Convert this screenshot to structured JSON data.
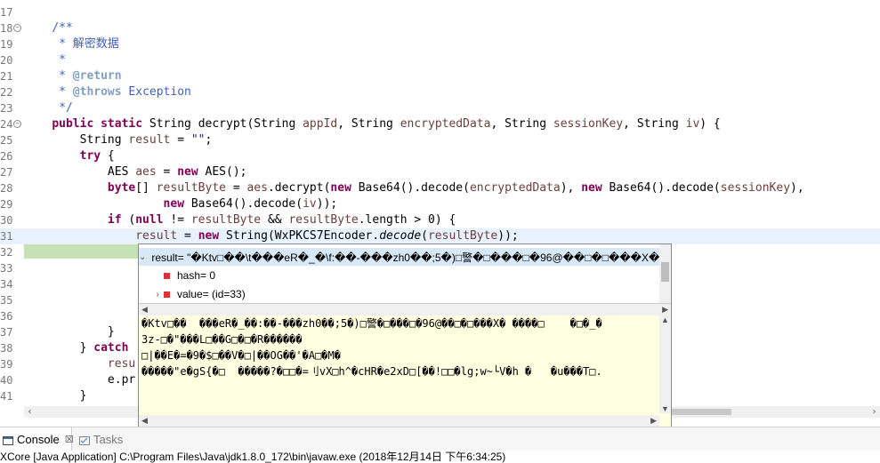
{
  "editor": {
    "lines": [
      {
        "num": "17",
        "html": ""
      },
      {
        "num": "18",
        "fold": "⊖",
        "html": "    <span class=\"cm\">/**</span>"
      },
      {
        "num": "19",
        "html": "<span class=\"cm\">     * 解密数据</span>"
      },
      {
        "num": "20",
        "html": "<span class=\"cm\">     *</span>"
      },
      {
        "num": "21",
        "html": "<span class=\"cm\">     * </span><span class=\"tag\">@return</span>"
      },
      {
        "num": "22",
        "html": "<span class=\"cm\">     * </span><span class=\"tag\">@throws</span><span class=\"cm\"> Exception</span>"
      },
      {
        "num": "23",
        "html": "<span class=\"cm\">     */</span>"
      },
      {
        "num": "24",
        "fold": "⊖",
        "html": "    <span class=\"kw\">public</span> <span class=\"kw\">static</span> String decrypt(String <span class=\"var\">appId</span>, String <span class=\"var\">encryptedData</span>, String <span class=\"var\">sessionKey</span>, String <span class=\"var\">iv</span>) {"
      },
      {
        "num": "25",
        "html": "        String <span class=\"var\">result</span> = <span class=\"str\">\"\"</span>;"
      },
      {
        "num": "26",
        "html": "        <span class=\"kw\">try</span> {"
      },
      {
        "num": "27",
        "html": "            AES <span class=\"var\">aes</span> = <span class=\"kw\">new</span> AES();"
      },
      {
        "num": "28",
        "html": "            <span class=\"kw\">byte</span>[] <span class=\"var\">resultByte</span> = <span class=\"var\">aes</span>.decrypt(<span class=\"kw\">new</span> Base64().decode(<span class=\"var\">encryptedData</span>), <span class=\"kw\">new</span> Base64().decode(<span class=\"var\">sessionKey</span>),"
      },
      {
        "num": "29",
        "html": "                    <span class=\"kw\">new</span> Base64().decode(<span class=\"var\">iv</span>));"
      },
      {
        "num": "30",
        "html": "            <span class=\"kw\">if</span> (<span class=\"kw\">null</span> != <span class=\"var\">resultByte</span> &amp;&amp; <span class=\"var\">resultByte</span>.length &gt; 0) {"
      },
      {
        "num": "31",
        "cur": true,
        "html": "                <span class=\"var\">result</span> = <span class=\"kw\">new</span> String(WxPKCS7Encoder.<span class=\"it\">decode</span>(<span class=\"var\">resultByte</span>));"
      },
      {
        "num": "32",
        "html": ""
      },
      {
        "num": "33",
        "html": ""
      },
      {
        "num": "34",
        "html": ""
      },
      {
        "num": "35",
        "html": ""
      },
      {
        "num": "36",
        "html": ""
      },
      {
        "num": "37",
        "html": "            }"
      },
      {
        "num": "38",
        "html": "        } <span class=\"kw\">catch</span>"
      },
      {
        "num": "39",
        "html": "            <span class=\"var\">resu</span>"
      },
      {
        "num": "40",
        "html": "            e.pr"
      },
      {
        "num": "41",
        "html": "        }"
      }
    ]
  },
  "debug_popup": {
    "tree": [
      {
        "expander": "⌄",
        "name": "result",
        "value": "\"�Ktv□��\\t���eR�_�\\f:��-���zh0��;5�)□警�□���□�96@��□�□���X� ����□\\t�□�_�'□g"
      },
      {
        "expander": "",
        "name": "hash",
        "value": "0"
      },
      {
        "expander": "›",
        "name": "value",
        "value": "(id=33)"
      }
    ],
    "detail_lines": [
      "�Ktv□��  ���eR�_��:��-���zh0��;5�)□警�□���□�96@��□�□���X� ����□    �□�_�",
      "3z-□�\"���L□��G□�□�R������",
      "□|��E�=�9�$□��V�□|��OG��'�A□�M�",
      "�����\"e�gS{�□  �����?�□□�=刂vX□h^�cHR�e2xD□[��!□□�lg;w~└V�h �   �u���T□."
    ]
  },
  "bottom_tabs": [
    {
      "label": "Console",
      "close": "☒",
      "icon": "console-icon"
    },
    {
      "label": "Tasks",
      "icon": "tasks-icon"
    }
  ],
  "status_line": "XCore [Java Application] C:\\Program Files\\Java\\jdk1.8.0_172\\bin\\javaw.exe (2018年12月14日 下午6:34:25)"
}
